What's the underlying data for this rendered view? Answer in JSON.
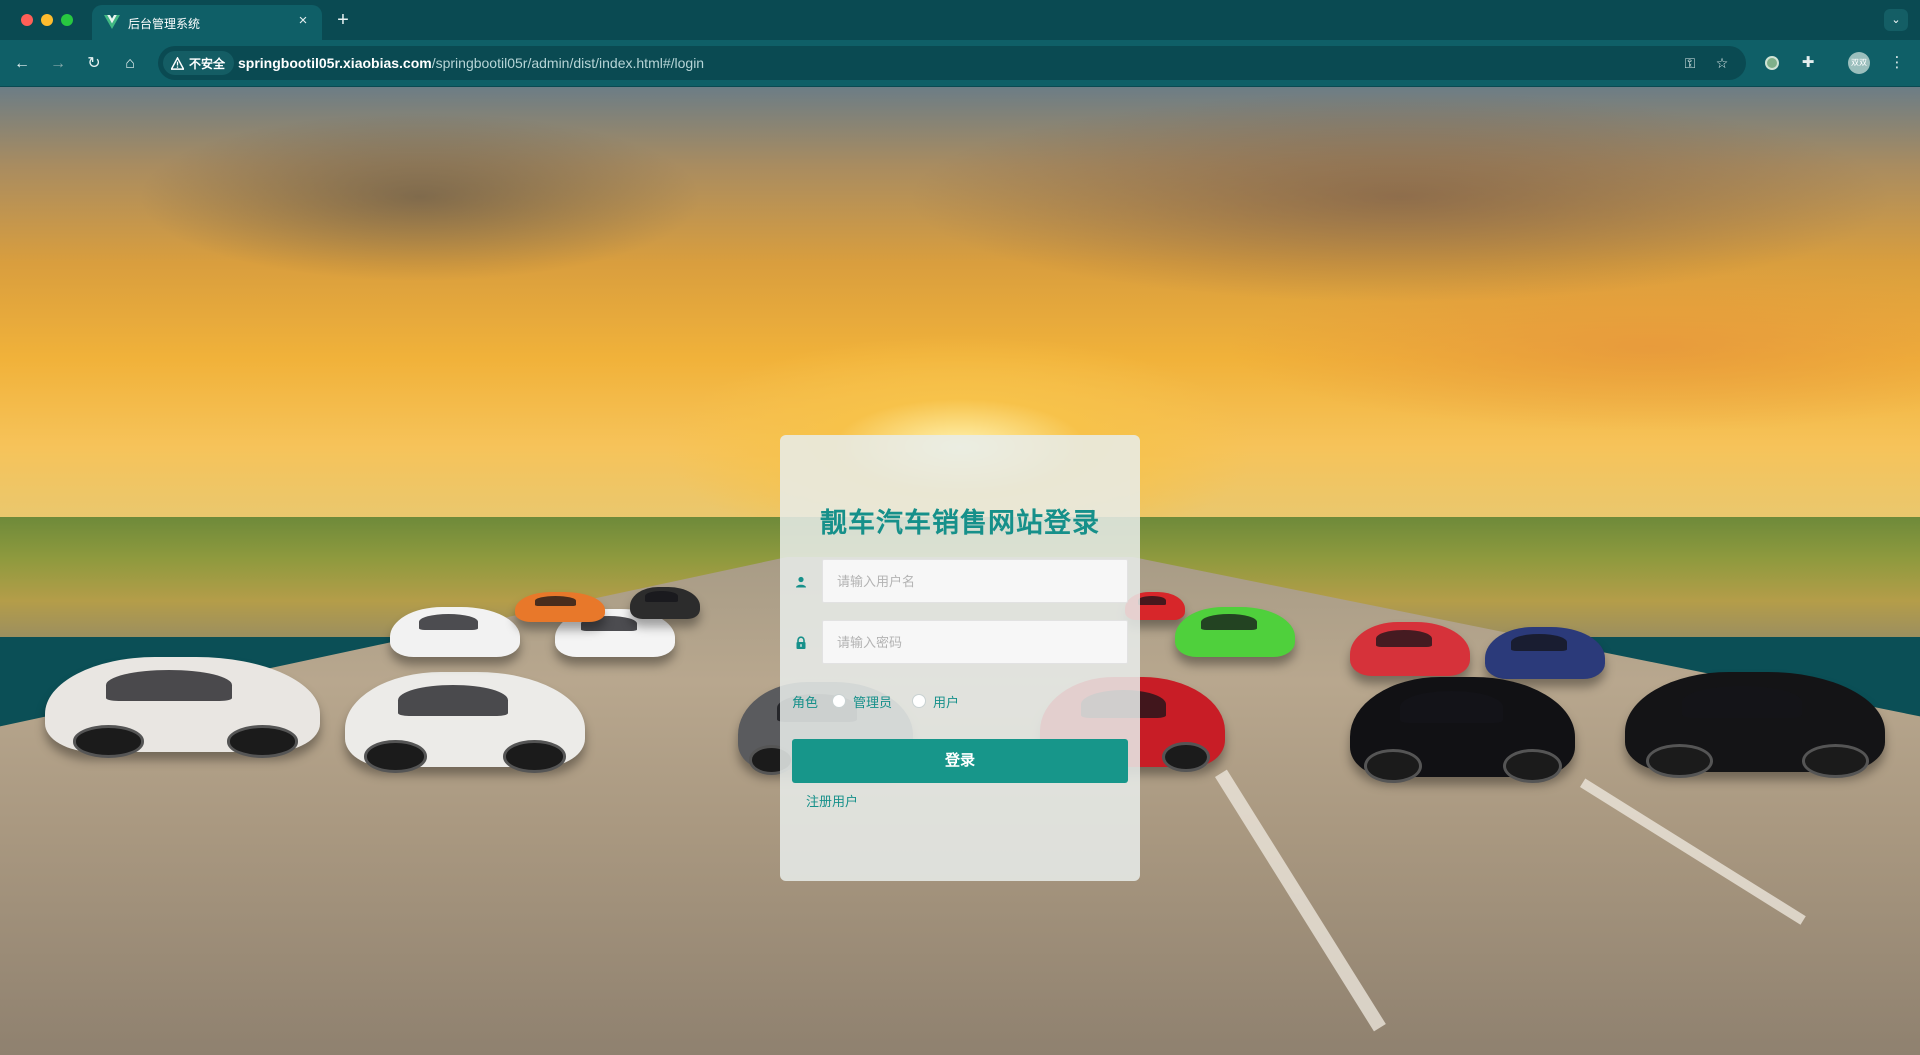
{
  "browser": {
    "tab_title": "后台管理系统",
    "tab_close": "×",
    "new_tab": "+",
    "security_label": "不安全",
    "url_host": "springbootil05r.xiaobias.com",
    "url_path": "/springbootil05r/admin/dist/index.html#/login",
    "profile_initials": "双双",
    "icons": {
      "back": "back-icon",
      "forward": "forward-icon",
      "reload": "reload-icon",
      "home": "home-icon",
      "warning": "warning-icon",
      "key": "key-icon",
      "star": "star-icon",
      "extensions": "puzzle-icon",
      "menu": "kebab-menu-icon"
    }
  },
  "login": {
    "title": "靓车汽车销售网站登录",
    "username_placeholder": "请输入用户名",
    "password_placeholder": "请输入密码",
    "role_label": "角色",
    "roles": [
      "管理员",
      "用户"
    ],
    "login_button": "登录",
    "register_link": "注册用户",
    "accent_color": "#16908a"
  }
}
